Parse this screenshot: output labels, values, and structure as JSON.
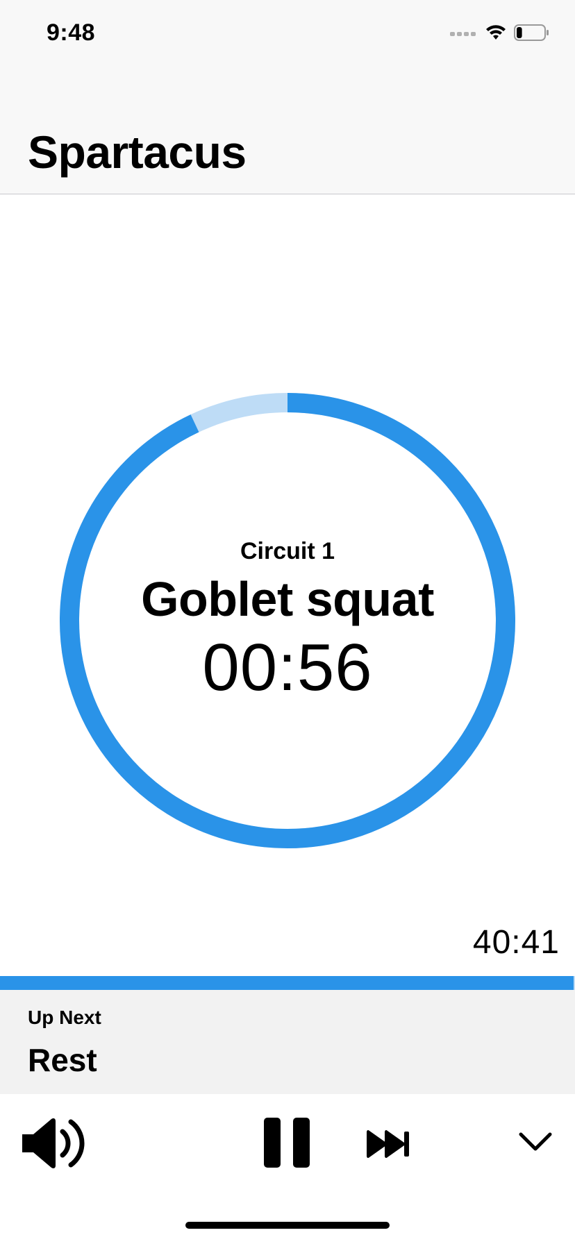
{
  "status_bar": {
    "time": "9:48",
    "icons": [
      "cellular-signal-icon",
      "wifi-icon",
      "battery-icon"
    ],
    "battery_level": 0.2
  },
  "header": {
    "title": "Spartacus"
  },
  "timer": {
    "circuit": "Circuit 1",
    "exercise": "Goblet squat",
    "remaining": "00:56",
    "elapsed_fraction": 0.07,
    "ring_color": "#2a93e8",
    "ring_track_color": "#bedcf6"
  },
  "workout": {
    "total_time": "40:41",
    "progress_fraction": 0.998
  },
  "up_next": {
    "label": "Up Next",
    "name": "Rest"
  },
  "toolbar": {
    "buttons": [
      "speaker-icon",
      "pause-icon",
      "skip-forward-icon",
      "chevron-down-icon"
    ]
  },
  "colors": {
    "accent": "#2a93e8",
    "header_bg": "#f8f8f8",
    "up_next_bg": "#f2f2f2"
  }
}
